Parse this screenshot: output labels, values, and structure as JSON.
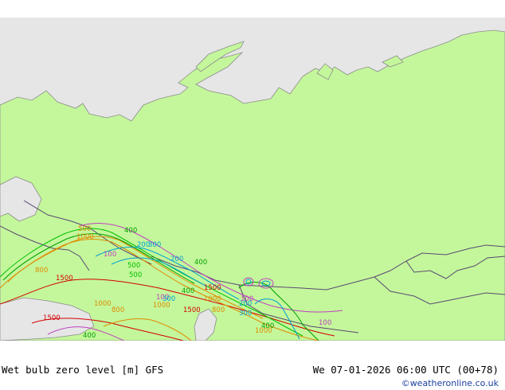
{
  "colors": {
    "land": "#c4f79b",
    "sea": "#e6e6e6",
    "border": "#5a4a72",
    "coast": "#8c8c8c",
    "credit": "#1a3fa0"
  },
  "footer": {
    "title": "Wet bulb zero level [m] GFS",
    "valid_time": "We 07-01-2026 06:00 UTC (00+78)",
    "credit": "©weatheronline.co.uk"
  },
  "contour_labels": [
    {
      "text": "500",
      "color": "#e08a00"
    },
    {
      "text": "1000",
      "color": "#e08a00"
    },
    {
      "text": "1500",
      "color": "#d40000"
    },
    {
      "text": "800",
      "color": "#e08a00"
    },
    {
      "text": "400",
      "color": "#00a000"
    },
    {
      "text": "300",
      "color": "#00a0d0"
    },
    {
      "text": "200",
      "color": "#00a0d0"
    },
    {
      "text": "100",
      "color": "#c040c0"
    },
    {
      "text": "500",
      "color": "#00c000"
    },
    {
      "text": "1000",
      "color": "#e08a00"
    },
    {
      "text": "1500",
      "color": "#d40000"
    },
    {
      "text": "1500",
      "color": "#d40000"
    },
    {
      "text": "1000",
      "color": "#e08a00"
    },
    {
      "text": "800",
      "color": "#e08a00"
    },
    {
      "text": "100",
      "color": "#c040c0"
    },
    {
      "text": "300",
      "color": "#00a0d0"
    },
    {
      "text": "400",
      "color": "#00a000"
    },
    {
      "text": "200",
      "color": "#00a0d0"
    },
    {
      "text": "500",
      "color": "#00c000"
    },
    {
      "text": "400",
      "color": "#00a000"
    },
    {
      "text": "200",
      "color": "#00a0d0"
    },
    {
      "text": "300",
      "color": "#00a0d0"
    },
    {
      "text": "100",
      "color": "#c040c0"
    },
    {
      "text": "400",
      "color": "#00a000"
    },
    {
      "text": "1000",
      "color": "#e08a00"
    },
    {
      "text": "100",
      "color": "#c040c0"
    },
    {
      "text": "800",
      "color": "#e08a00"
    },
    {
      "text": "400",
      "color": "#00a000"
    },
    {
      "text": "1500",
      "color": "#d40000"
    },
    {
      "text": "1000",
      "color": "#e08a00"
    }
  ]
}
